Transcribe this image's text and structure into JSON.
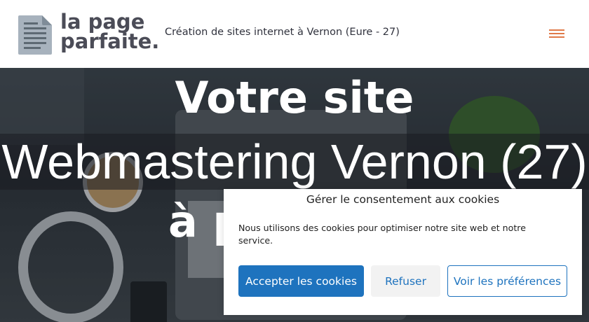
{
  "header": {
    "logo_line1": "la page",
    "logo_line2": "parfaite.",
    "tagline": "Création de sites internet à Vernon (Eure - 27)"
  },
  "hero": {
    "title_line1": "Votre site",
    "title_line3": "à p",
    "band_text": "Webmastering Vernon (27)"
  },
  "cookie_banner": {
    "title": "Gérer le consentement aux cookies",
    "text": "Nous utilisons des cookies pour optimiser notre site web et notre service.",
    "accept_label": "Accepter les cookies",
    "refuse_label": "Refuser",
    "preferences_label": "Voir les préférences"
  },
  "colors": {
    "accent": "#1e73be",
    "menu_icon": "#e07a49",
    "logo_text": "#4b4c57"
  }
}
